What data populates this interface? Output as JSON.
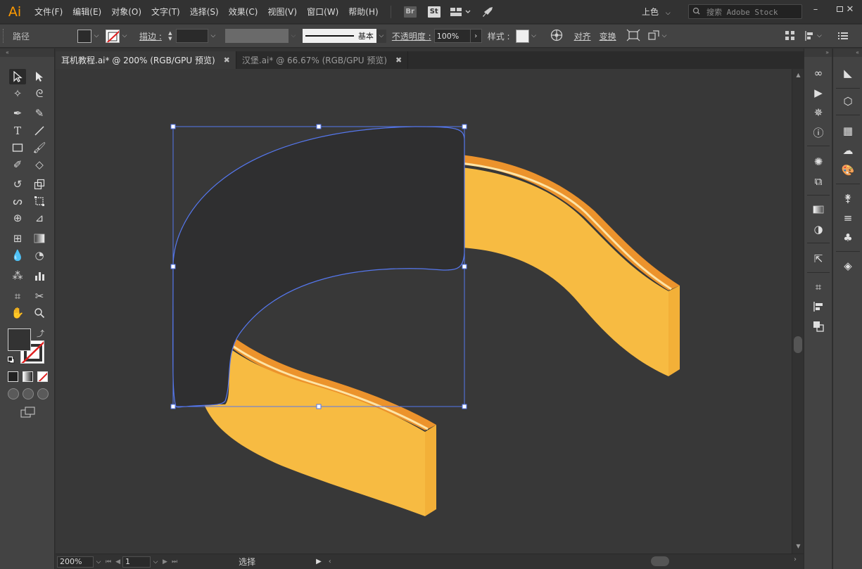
{
  "app": {
    "logo": "Ai",
    "menus": [
      "文件(F)",
      "编辑(E)",
      "对象(O)",
      "文字(T)",
      "选择(S)",
      "效果(C)",
      "视图(V)",
      "窗口(W)",
      "帮助(H)"
    ],
    "bridge_badge": "Br",
    "stock_badge": "St",
    "workspace": "上色",
    "search_placeholder": "搜索 Adobe Stock"
  },
  "control_bar": {
    "selection_type": "路径",
    "stroke_label": "描边 :",
    "brush_style": "基本",
    "opacity_label": "不透明度 :",
    "opacity_value": "100%",
    "style_label": "样式 :",
    "align_label": "对齐",
    "transform_label": "变换"
  },
  "tabs": [
    {
      "label": "耳机教程.ai* @ 200% (RGB/GPU 预览)",
      "active": true,
      "close": "✖"
    },
    {
      "label": "汉堡.ai* @ 66.67% (RGB/GPU 预览)",
      "active": false,
      "close": "✖"
    }
  ],
  "status_bar": {
    "zoom": "200%",
    "artboard": "1",
    "tool": "选择"
  },
  "colors": {
    "band_fill": "#f7bb42",
    "band_edge": "#ec932c",
    "band_highlight": "#fde4a6",
    "band_side": "#f3b038",
    "selected_shape_fill": "#2f2f30",
    "selection_stroke": "#5577ee",
    "accent": "#ff9a00"
  },
  "icons": {
    "tools": [
      "selection-tool-icon",
      "direct-selection-tool-icon",
      "magic-wand-icon",
      "lasso-icon",
      "pen-icon",
      "curvature-icon",
      "type-icon",
      "line-icon",
      "rectangle-icon",
      "paintbrush-icon",
      "shaper-icon",
      "eraser-icon",
      "rotate-icon",
      "scale-icon",
      "warp-icon",
      "free-transform-icon",
      "shape-builder-icon",
      "perspective-icon",
      "mesh-icon",
      "gradient-icon",
      "eyedropper-icon",
      "blend-icon",
      "symbol-sprayer-icon",
      "graph-icon",
      "artboard-icon",
      "slice-icon",
      "hand-icon",
      "zoom-icon"
    ]
  }
}
